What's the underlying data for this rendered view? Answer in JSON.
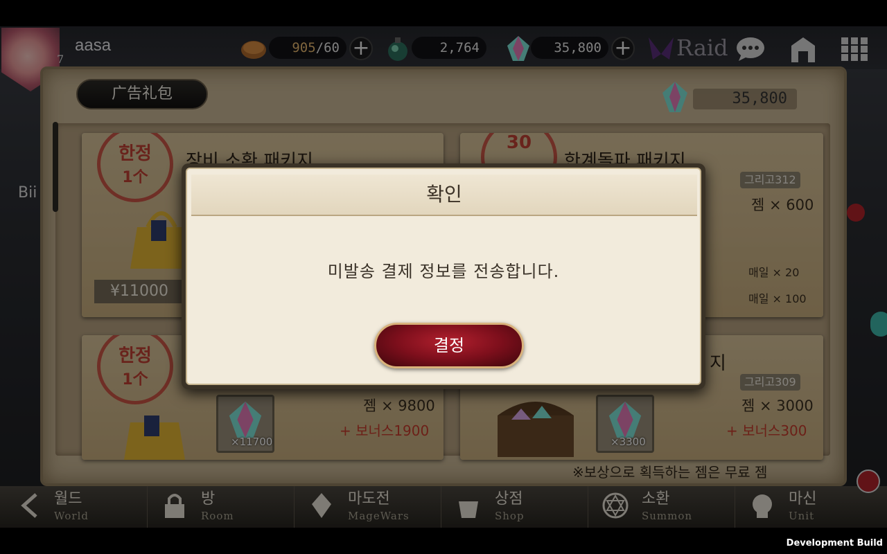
{
  "player": {
    "name": "aasa",
    "level": "7"
  },
  "resources": {
    "stamina_current": "905",
    "stamina_max": "/60",
    "potion": "2,764",
    "gems": "35,800"
  },
  "top_icons": {
    "raid_label": "Raid"
  },
  "panel": {
    "tab_label": "广告礼包",
    "gem_balance": "35,800",
    "footer_note": "※보상으로 획득하는 젬은 무료 젬"
  },
  "cards": [
    {
      "stamp_top": "한정",
      "stamp_bottom": "1个",
      "title": "장비 소환 패키지",
      "price": "¥11000"
    },
    {
      "stamp_top": "30",
      "stamp_bottom": "",
      "title": "한계돌파 패키지",
      "tag": "그리고312",
      "gem_line": "젬 × 600",
      "daily1": "매일 × 20",
      "daily2": "매일 × 100"
    },
    {
      "stamp_top": "한정",
      "stamp_bottom": "1个",
      "title": "",
      "gem_line": "젬 × 9800",
      "bonus": "+ 보너스1900",
      "gem_count": "×11700"
    },
    {
      "title": "지",
      "tag": "그리고309",
      "gem_line": "젬 × 3000",
      "bonus": "+ 보너스300",
      "gem_count": "×3300"
    }
  ],
  "dialog": {
    "title": "확인",
    "message": "미발송 결제 정보를 전송합니다.",
    "confirm_label": "결정"
  },
  "side": {
    "left_label": "Bii"
  },
  "nav": [
    {
      "kr": "월드",
      "en": "World"
    },
    {
      "kr": "방",
      "en": "Room"
    },
    {
      "kr": "마도전",
      "en": "MageWars"
    },
    {
      "kr": "상점",
      "en": "Shop"
    },
    {
      "kr": "소환",
      "en": "Summon"
    },
    {
      "kr": "마신",
      "en": "Unit"
    }
  ],
  "build_label": "Development Build",
  "colors": {
    "accent_red": "#b2202e",
    "parchment": "#f2ebdc",
    "gold": "#e7b970"
  }
}
